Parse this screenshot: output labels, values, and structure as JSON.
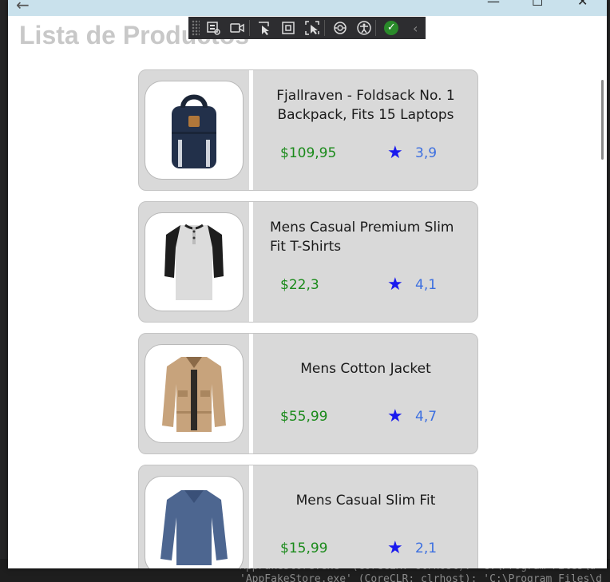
{
  "window": {
    "back": "←",
    "minimize": "—",
    "maximize": "☐",
    "close": "✕"
  },
  "header": {
    "title": "Lista de Productos"
  },
  "devtools": {
    "icons": [
      "live-visual-tree-icon",
      "video-icon",
      "select-element-icon",
      "display-layout-adorners-icon",
      "track-focus-icon",
      "binding-failures-icon",
      "accessibility-icon",
      "check-ok-icon",
      "collapse-chevron-icon"
    ],
    "ok_glyph": "✓",
    "chevron_glyph": "‹"
  },
  "products": [
    {
      "name": "Fjallraven - Foldsack No. 1 Backpack, Fits 15 Laptops",
      "price": "$109,95",
      "rating": "3,9",
      "image": "backpack"
    },
    {
      "name": "Mens Casual Premium Slim Fit T-Shirts",
      "price": "$22,3",
      "rating": "4,1",
      "image": "tshirt"
    },
    {
      "name": "Mens Cotton Jacket",
      "price": "$55,99",
      "rating": "4,7",
      "image": "jacket"
    },
    {
      "name": "Mens Casual Slim Fit",
      "price": "$15,99",
      "rating": "2,1",
      "image": "longsleeve"
    }
  ],
  "star_glyph": "★",
  "colors": {
    "price": "#1a8a1a",
    "rating": "#3c6fe0",
    "star": "#1a1aee",
    "titlebar": "#c9e1ec"
  },
  "background_code": [
    "AppFakeStore.exe' (CoreCLR: clrhost): 'C:\\Program Files\\d",
    "'AppFakeStore.exe' (CoreCLR: clrhost): 'C:\\Program Files\\d"
  ]
}
